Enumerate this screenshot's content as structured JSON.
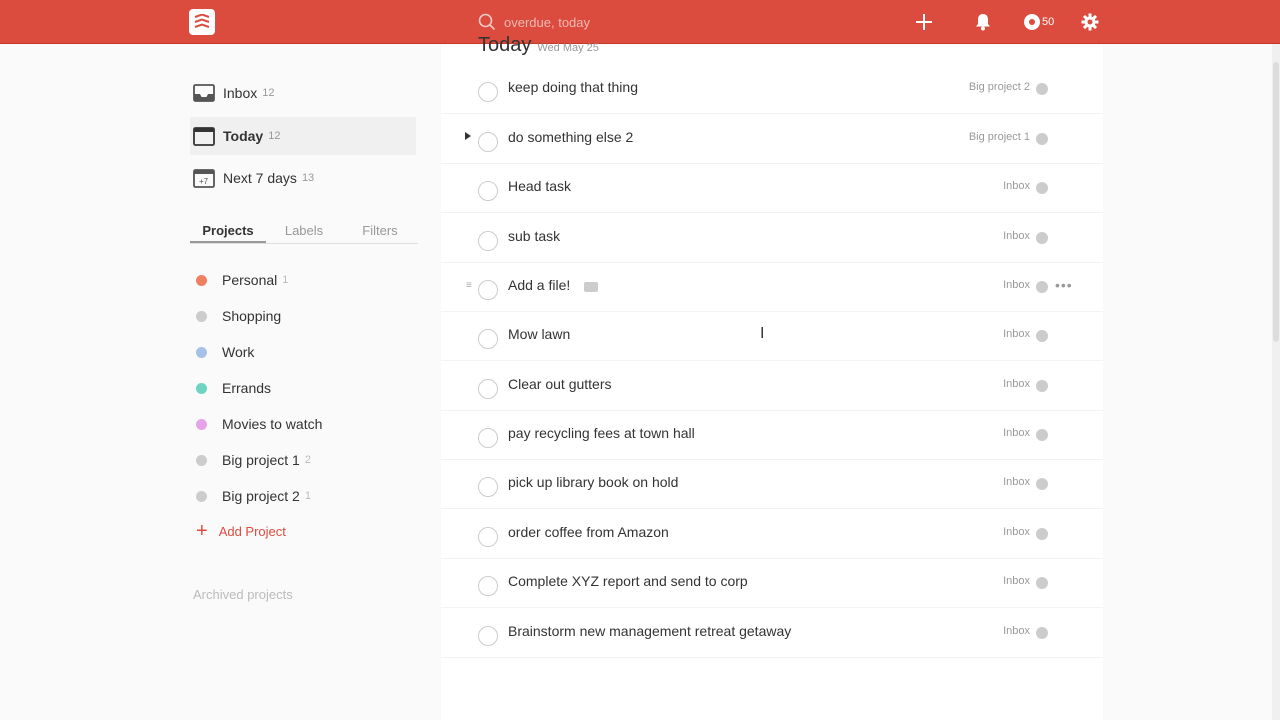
{
  "topbar": {
    "search_placeholder": "overdue, today",
    "karma": "50",
    "icons": {
      "logo": "todoist-logo-icon",
      "search": "search-icon",
      "add": "plus-icon",
      "notifications": "bell-icon",
      "karma": "karma-icon",
      "settings": "gear-icon"
    },
    "accent_color": "#db4c3f"
  },
  "sidebar": {
    "nav": [
      {
        "label": "Inbox",
        "count": "12",
        "icon": "inbox-icon"
      },
      {
        "label": "Today",
        "count": "12",
        "icon": "calendar-today-icon"
      },
      {
        "label": "Next 7 days",
        "count": "13",
        "icon": "calendar-week-icon"
      }
    ],
    "tabs": [
      "Projects",
      "Labels",
      "Filters"
    ],
    "projects": [
      {
        "name": "Personal",
        "count": "1",
        "color": "#f07f62"
      },
      {
        "name": "Shopping",
        "count": "",
        "color": "#cccccc"
      },
      {
        "name": "Work",
        "count": "",
        "color": "#a6c1e6"
      },
      {
        "name": "Errands",
        "count": "",
        "color": "#6ed4c1"
      },
      {
        "name": "Movies to watch",
        "count": "",
        "color": "#e5a3e8"
      },
      {
        "name": "Big project 1",
        "count": "2",
        "color": "#cccccc"
      },
      {
        "name": "Big project 2",
        "count": "1",
        "color": "#cccccc"
      }
    ],
    "add_project": "Add Project",
    "archived": "Archived projects"
  },
  "main": {
    "title": "Today",
    "date": "Wed May 25",
    "tasks": [
      {
        "content": "keep doing that thing",
        "project": "Big project 2"
      },
      {
        "content": "do something else 2",
        "project": "Big project 1"
      },
      {
        "content": "Head task",
        "project": "Inbox"
      },
      {
        "content": "sub task",
        "project": "Inbox"
      },
      {
        "content": "Add a file!",
        "project": "Inbox"
      },
      {
        "content": "Mow lawn",
        "project": "Inbox"
      },
      {
        "content": "Clear out gutters",
        "project": "Inbox"
      },
      {
        "content": "pay recycling fees at town hall",
        "project": "Inbox"
      },
      {
        "content": "pick up library book on hold",
        "project": "Inbox"
      },
      {
        "content": "order coffee from Amazon",
        "project": "Inbox"
      },
      {
        "content": "Complete XYZ report and send to corp",
        "project": "Inbox"
      },
      {
        "content": "Brainstorm new management retreat getaway",
        "project": "Inbox"
      }
    ]
  }
}
